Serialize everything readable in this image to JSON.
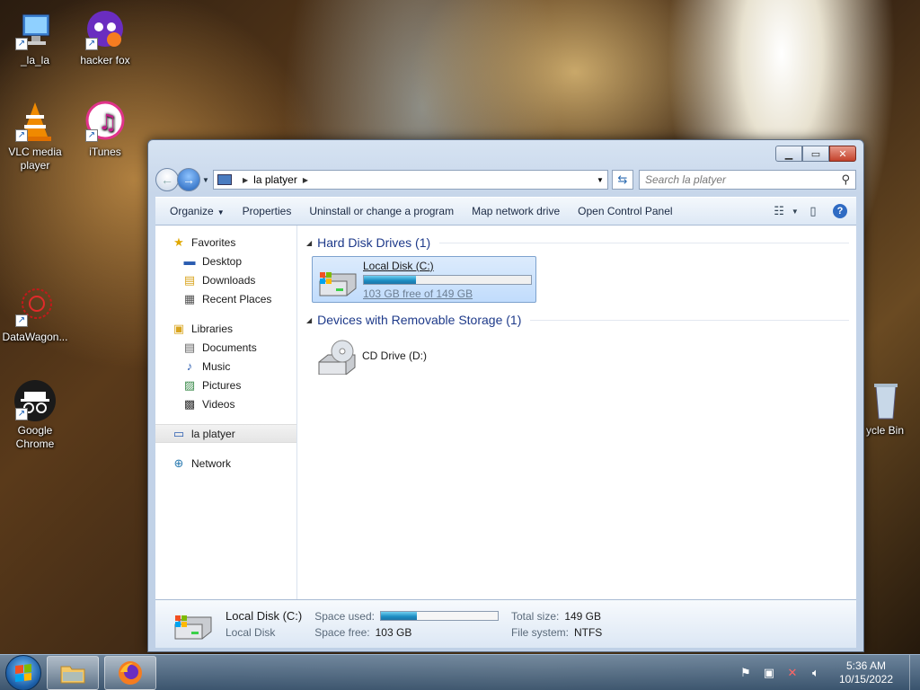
{
  "desktop": {
    "icons": [
      {
        "label": "_la_la"
      },
      {
        "label": "hacker fox"
      },
      {
        "label": "VLC media player"
      },
      {
        "label": "iTunes"
      },
      {
        "label": "DataWagon..."
      },
      {
        "label": "Google Chrome"
      },
      {
        "label": "ycle Bin"
      }
    ]
  },
  "window": {
    "address": {
      "crumb": "la platyer"
    },
    "search": {
      "placeholder": "Search la platyer"
    },
    "toolbar": {
      "organize": "Organize",
      "properties": "Properties",
      "uninstall": "Uninstall or change a program",
      "map_drive": "Map network drive",
      "control_panel": "Open Control Panel"
    },
    "nav": {
      "favorites": "Favorites",
      "desktop": "Desktop",
      "downloads": "Downloads",
      "recent": "Recent Places",
      "libraries": "Libraries",
      "documents": "Documents",
      "music": "Music",
      "pictures": "Pictures",
      "videos": "Videos",
      "computer": "la platyer",
      "network": "Network"
    },
    "groups": {
      "hdd_title": "Hard Disk Drives (1)",
      "removable_title": "Devices with Removable Storage (1)"
    },
    "drives": {
      "c": {
        "name": "Local Disk (C:)",
        "free_text": "103 GB free of 149 GB",
        "used_fraction": 0.31
      },
      "d": {
        "name": "CD Drive (D:)"
      }
    },
    "details": {
      "name": "Local Disk (C:)",
      "type": "Local Disk",
      "space_used_label": "Space used:",
      "space_free_label": "Space free:",
      "space_free": "103 GB",
      "total_label": "Total size:",
      "total": "149 GB",
      "fs_label": "File system:",
      "fs": "NTFS",
      "used_fraction": 0.31
    }
  },
  "taskbar": {
    "time": "5:36 AM",
    "date": "10/15/2022"
  },
  "colors": {
    "accent": "#1e3a8a",
    "bar_fill": "#1a8cc2"
  }
}
